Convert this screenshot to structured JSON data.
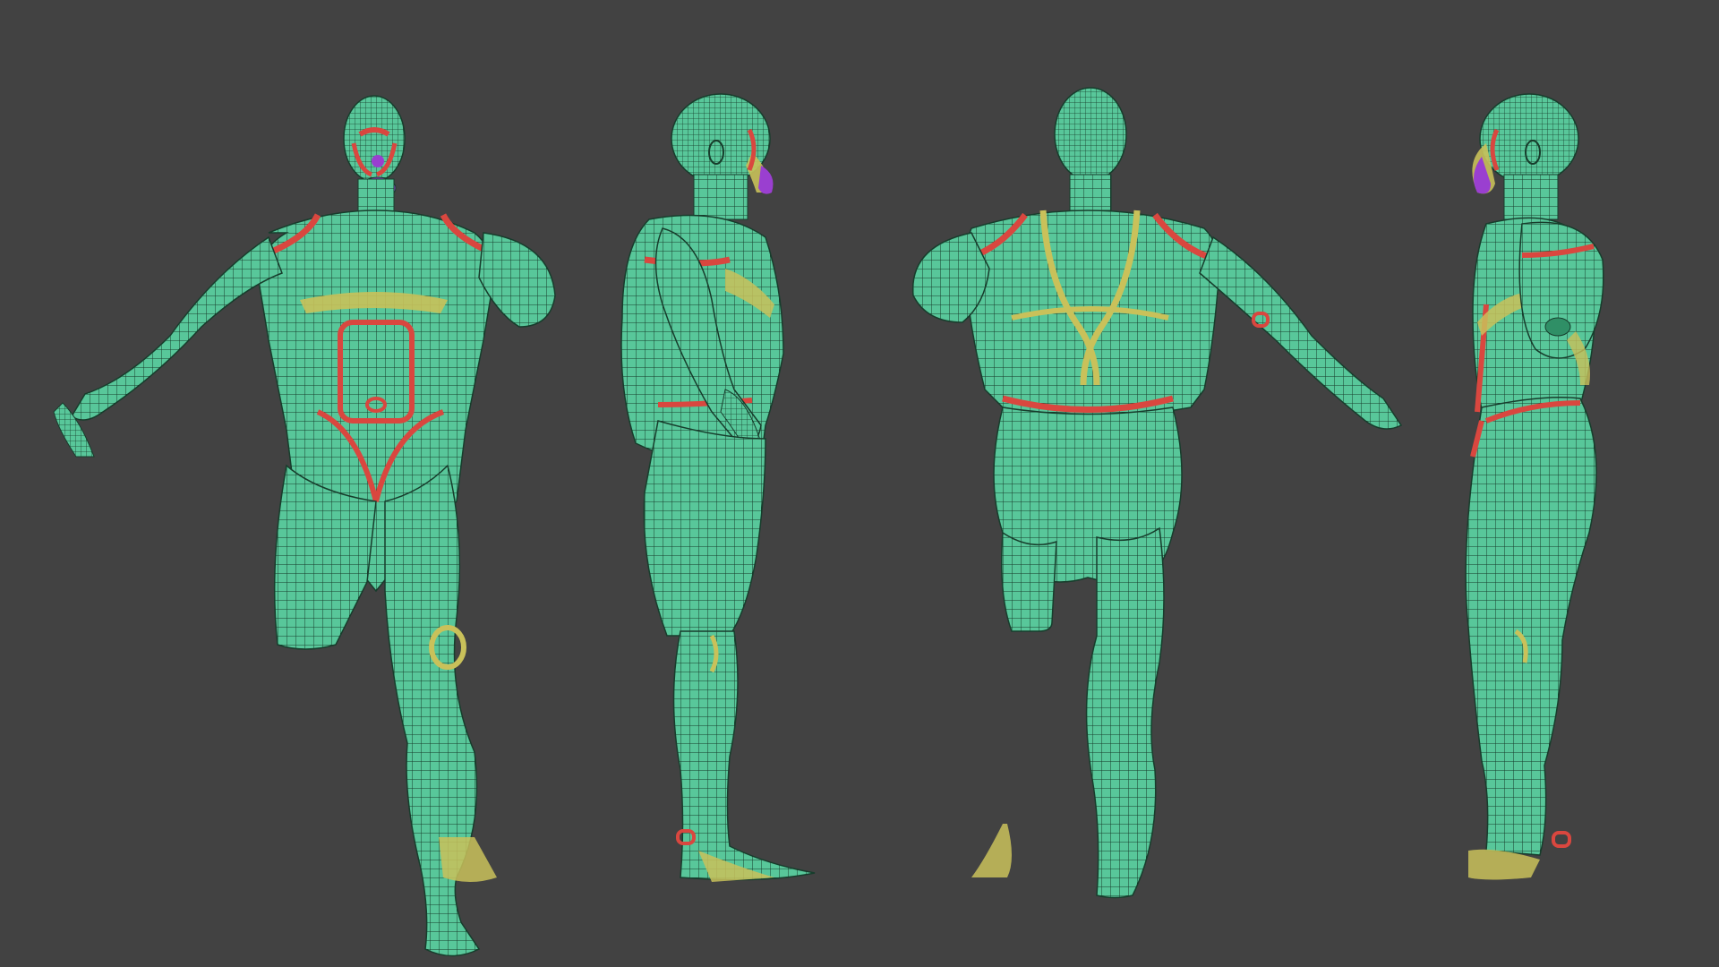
{
  "scene": {
    "background": "#424242",
    "views": [
      {
        "name": "front-view"
      },
      {
        "name": "side-view-right"
      },
      {
        "name": "back-view"
      },
      {
        "name": "side-view-left"
      }
    ],
    "colors": {
      "mesh_base": "#58c79a",
      "mesh_shade": "#2f8f66",
      "wire": "#0f2a1f",
      "edge_loop_red": "#d9473f",
      "edge_loop_yellow": "#c9c15a",
      "face_purple": "#9a3fd0"
    }
  }
}
